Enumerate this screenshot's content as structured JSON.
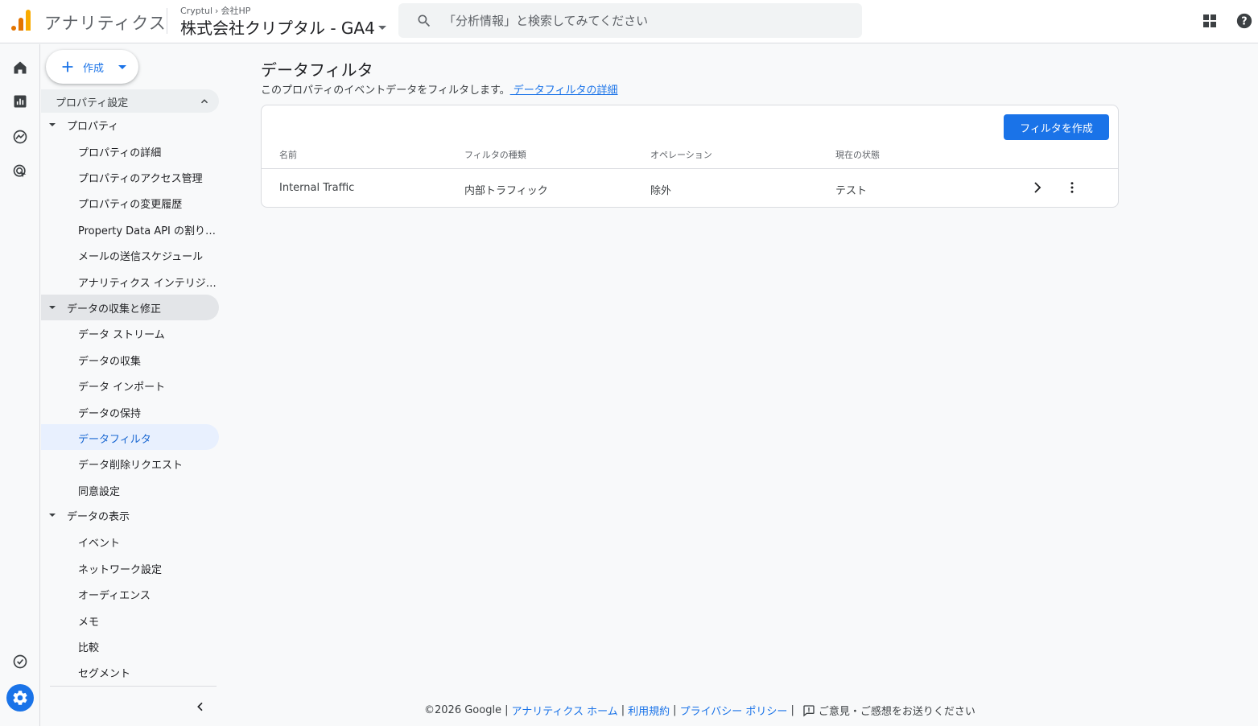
{
  "header": {
    "app_name": "アナリティクス",
    "account_path": [
      "Cryptul",
      "会社HP"
    ],
    "property_name": "株式会社クリプタル - GA4",
    "search_placeholder": "「分析情報」と検索してみてください"
  },
  "rail": {
    "icons": [
      "home-icon",
      "reports-icon",
      "explore-icon",
      "advertising-icon",
      "insights-check-icon",
      "admin-gear-icon"
    ]
  },
  "nav": {
    "create_label": "作成",
    "section_title": "プロパティ設定",
    "groups": [
      {
        "label": "プロパティ",
        "items": [
          "プロパティの詳細",
          "プロパティのアクセス管理",
          "プロパティの変更履歴",
          "Property Data API の割り当て",
          "メールの送信スケジュール",
          "アナリティクス インテリジェンス"
        ]
      },
      {
        "label": "データの収集と修正",
        "items": [
          "データ ストリーム",
          "データの収集",
          "データ インポート",
          "データの保持",
          "データフィルタ",
          "データ削除リクエスト",
          "同意設定"
        ]
      },
      {
        "label": "データの表示",
        "items": [
          "イベント",
          "ネットワーク設定",
          "オーディエンス",
          "メモ",
          "比較",
          "セグメント"
        ]
      }
    ],
    "selected_item": "データフィルタ"
  },
  "main": {
    "title": "データフィルタ",
    "description": "このプロパティのイベントデータをフィルタします。",
    "description_link": " データフィルタの詳細",
    "create_button": "フィルタを作成",
    "columns": [
      "名前",
      "フィルタの種類",
      "オペレーション",
      "現在の状態"
    ],
    "rows": [
      {
        "name": "Internal Traffic",
        "type": "内部トラフィック",
        "operation": "除外",
        "state": "テスト"
      }
    ]
  },
  "footer": {
    "copyright": "©2026 Google",
    "links": [
      "アナリティクス ホーム",
      "利用規約",
      "プライバシー ポリシー"
    ],
    "feedback": "ご意見・ご感想をお送りください"
  },
  "colors": {
    "accent": "#1a73e8",
    "logo_orange": "#e37400",
    "logo_yellow": "#f9ab00",
    "selected_bg": "#e8f0fe"
  }
}
